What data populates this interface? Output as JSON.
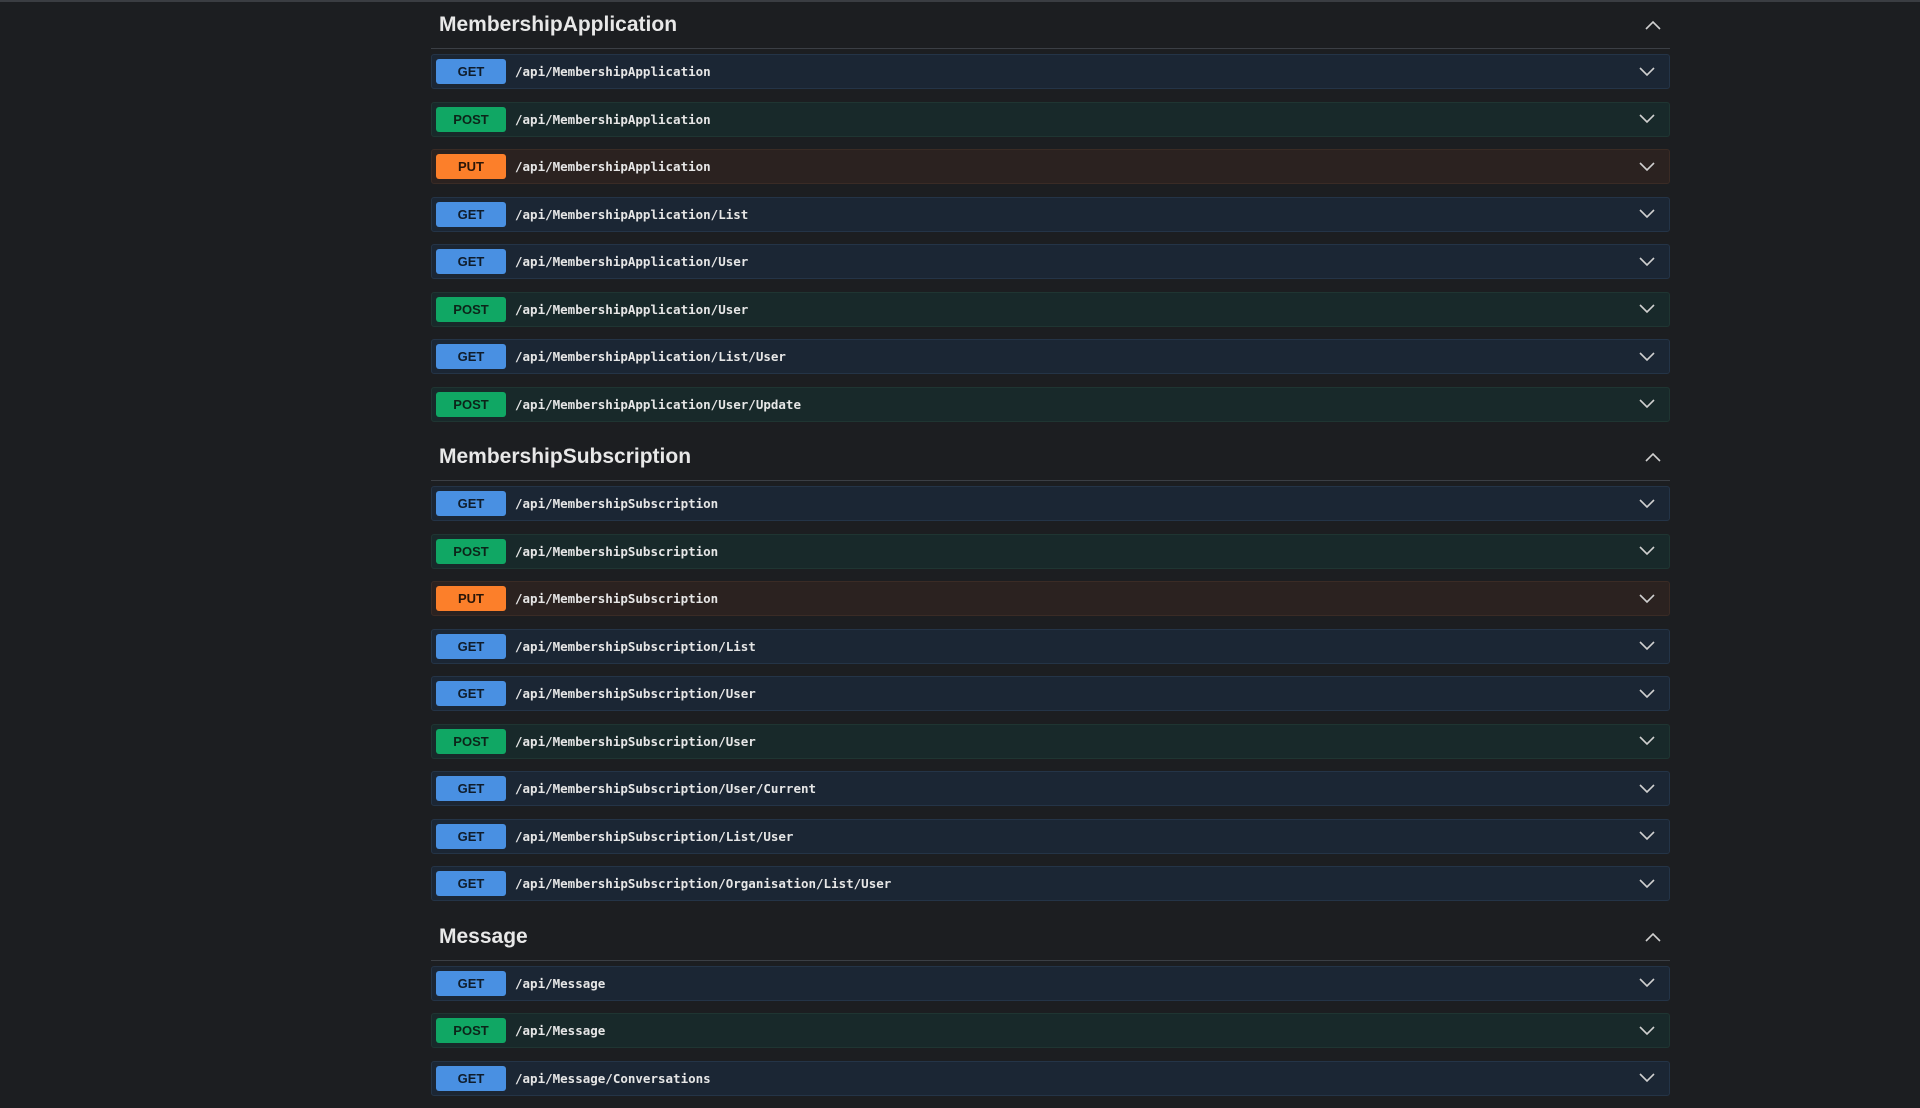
{
  "sections": [
    {
      "title": "MembershipApplication",
      "operations": [
        {
          "method": "GET",
          "path": "/api/MembershipApplication"
        },
        {
          "method": "POST",
          "path": "/api/MembershipApplication"
        },
        {
          "method": "PUT",
          "path": "/api/MembershipApplication"
        },
        {
          "method": "GET",
          "path": "/api/MembershipApplication/List"
        },
        {
          "method": "GET",
          "path": "/api/MembershipApplication/User"
        },
        {
          "method": "POST",
          "path": "/api/MembershipApplication/User"
        },
        {
          "method": "GET",
          "path": "/api/MembershipApplication/List/User"
        },
        {
          "method": "POST",
          "path": "/api/MembershipApplication/User/Update"
        }
      ]
    },
    {
      "title": "MembershipSubscription",
      "operations": [
        {
          "method": "GET",
          "path": "/api/MembershipSubscription"
        },
        {
          "method": "POST",
          "path": "/api/MembershipSubscription"
        },
        {
          "method": "PUT",
          "path": "/api/MembershipSubscription"
        },
        {
          "method": "GET",
          "path": "/api/MembershipSubscription/List"
        },
        {
          "method": "GET",
          "path": "/api/MembershipSubscription/User"
        },
        {
          "method": "POST",
          "path": "/api/MembershipSubscription/User"
        },
        {
          "method": "GET",
          "path": "/api/MembershipSubscription/User/Current"
        },
        {
          "method": "GET",
          "path": "/api/MembershipSubscription/List/User"
        },
        {
          "method": "GET",
          "path": "/api/MembershipSubscription/Organisation/List/User"
        }
      ]
    },
    {
      "title": "Message",
      "operations": [
        {
          "method": "GET",
          "path": "/api/Message"
        },
        {
          "method": "POST",
          "path": "/api/Message"
        },
        {
          "method": "GET",
          "path": "/api/Message/Conversations"
        }
      ]
    }
  ],
  "icons": {
    "section_toggle": "chevron-up-icon",
    "operation_toggle": "chevron-down-icon"
  },
  "colors": {
    "get": "#4990e2",
    "post": "#10a764",
    "put": "#fc7f2a",
    "background": "#1c1e21"
  }
}
